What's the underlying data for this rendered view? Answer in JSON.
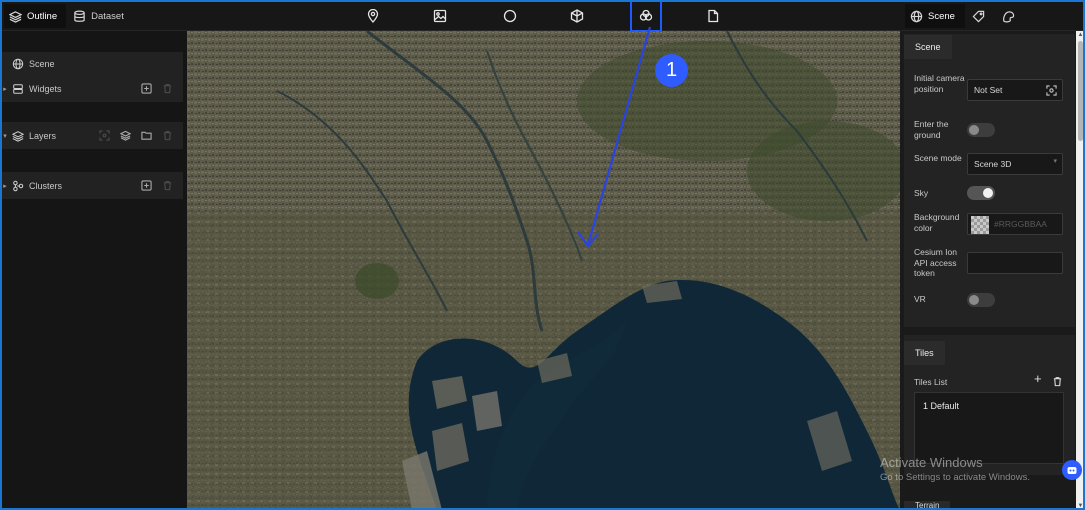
{
  "left_tabs": [
    {
      "label": "Outline",
      "icon": "layers-icon",
      "active": true
    },
    {
      "label": "Dataset",
      "icon": "database-icon",
      "active": false
    }
  ],
  "center_tools": [
    {
      "icon": "map-pin-icon"
    },
    {
      "icon": "image-icon"
    },
    {
      "icon": "circle-icon"
    },
    {
      "icon": "globe-box-icon"
    },
    {
      "icon": "clusters-icon",
      "highlighted": true
    },
    {
      "icon": "document-icon"
    }
  ],
  "right_tabs": [
    {
      "label": "Scene",
      "icon": "globe-icon",
      "active": true
    },
    {
      "label": "",
      "icon": "tag-icon"
    },
    {
      "label": "",
      "icon": "paint-icon"
    }
  ],
  "outline": {
    "scene": "Scene",
    "widgets": "Widgets",
    "layers": "Layers",
    "clusters": "Clusters"
  },
  "annotation": {
    "number": "1"
  },
  "scene_panel": {
    "title": "Scene",
    "initial_camera_label": "Initial camera position",
    "initial_camera_value": "Not Set",
    "enter_ground_label": "Enter the ground",
    "enter_ground_on": false,
    "scene_mode_label": "Scene mode",
    "scene_mode_value": "Scene 3D",
    "sky_label": "Sky",
    "sky_on": true,
    "bg_color_label": "Background color",
    "bg_color_placeholder": "#RRGGBBAA",
    "cesium_label": "Cesium Ion API access token",
    "vr_label": "VR",
    "vr_on": false
  },
  "tiles_panel": {
    "title": "Tiles",
    "list_label": "Tiles List",
    "items": [
      "1  Default"
    ]
  },
  "next_section_label": "Terrain",
  "watermark": {
    "line1": "Activate Windows",
    "line2": "Go to Settings to activate Windows."
  },
  "colors": {
    "accent": "#1e5bff",
    "panel": "#232323",
    "bg": "#151515"
  }
}
